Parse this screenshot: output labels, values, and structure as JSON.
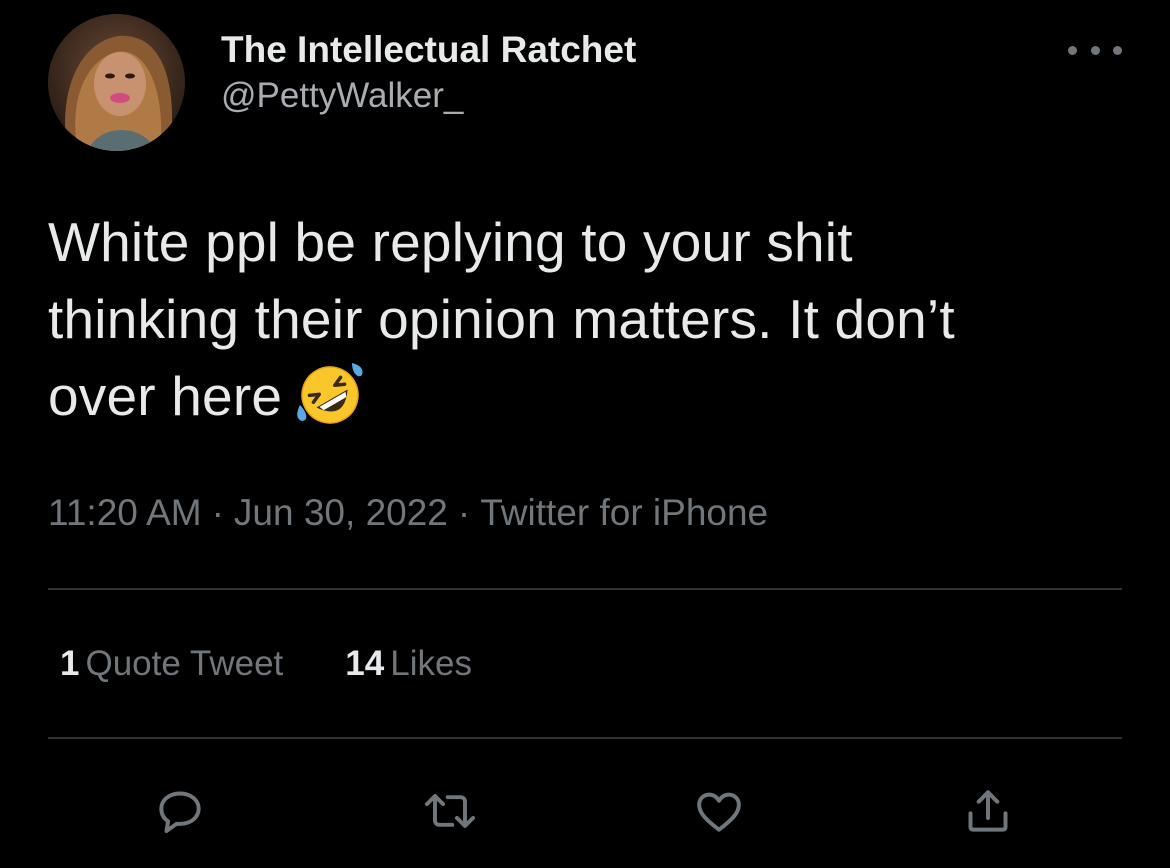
{
  "tweet": {
    "author": {
      "display_name": "The Intellectual Ratchet",
      "handle": "@PettyWalker_"
    },
    "text": "White ppl be replying to your shit thinking their opinion matters. It don’t over here",
    "emoji": "rolling-on-the-floor-laughing",
    "meta": {
      "time": "11:20 AM",
      "date": "Jun 30, 2022",
      "source": "Twitter for iPhone",
      "separator": "·"
    },
    "stats": {
      "quote_count": "1",
      "quote_label": "Quote Tweet",
      "like_count": "14",
      "like_label": "Likes"
    }
  },
  "actions": [
    {
      "name": "reply",
      "icon": "speech-bubble-icon"
    },
    {
      "name": "retweet",
      "icon": "retweet-icon"
    },
    {
      "name": "like",
      "icon": "heart-icon"
    },
    {
      "name": "share",
      "icon": "share-icon"
    }
  ],
  "colors": {
    "background": "#000000",
    "primary_text": "#e7e9ea",
    "secondary_text": "#71767b",
    "divider": "#2f3336"
  }
}
